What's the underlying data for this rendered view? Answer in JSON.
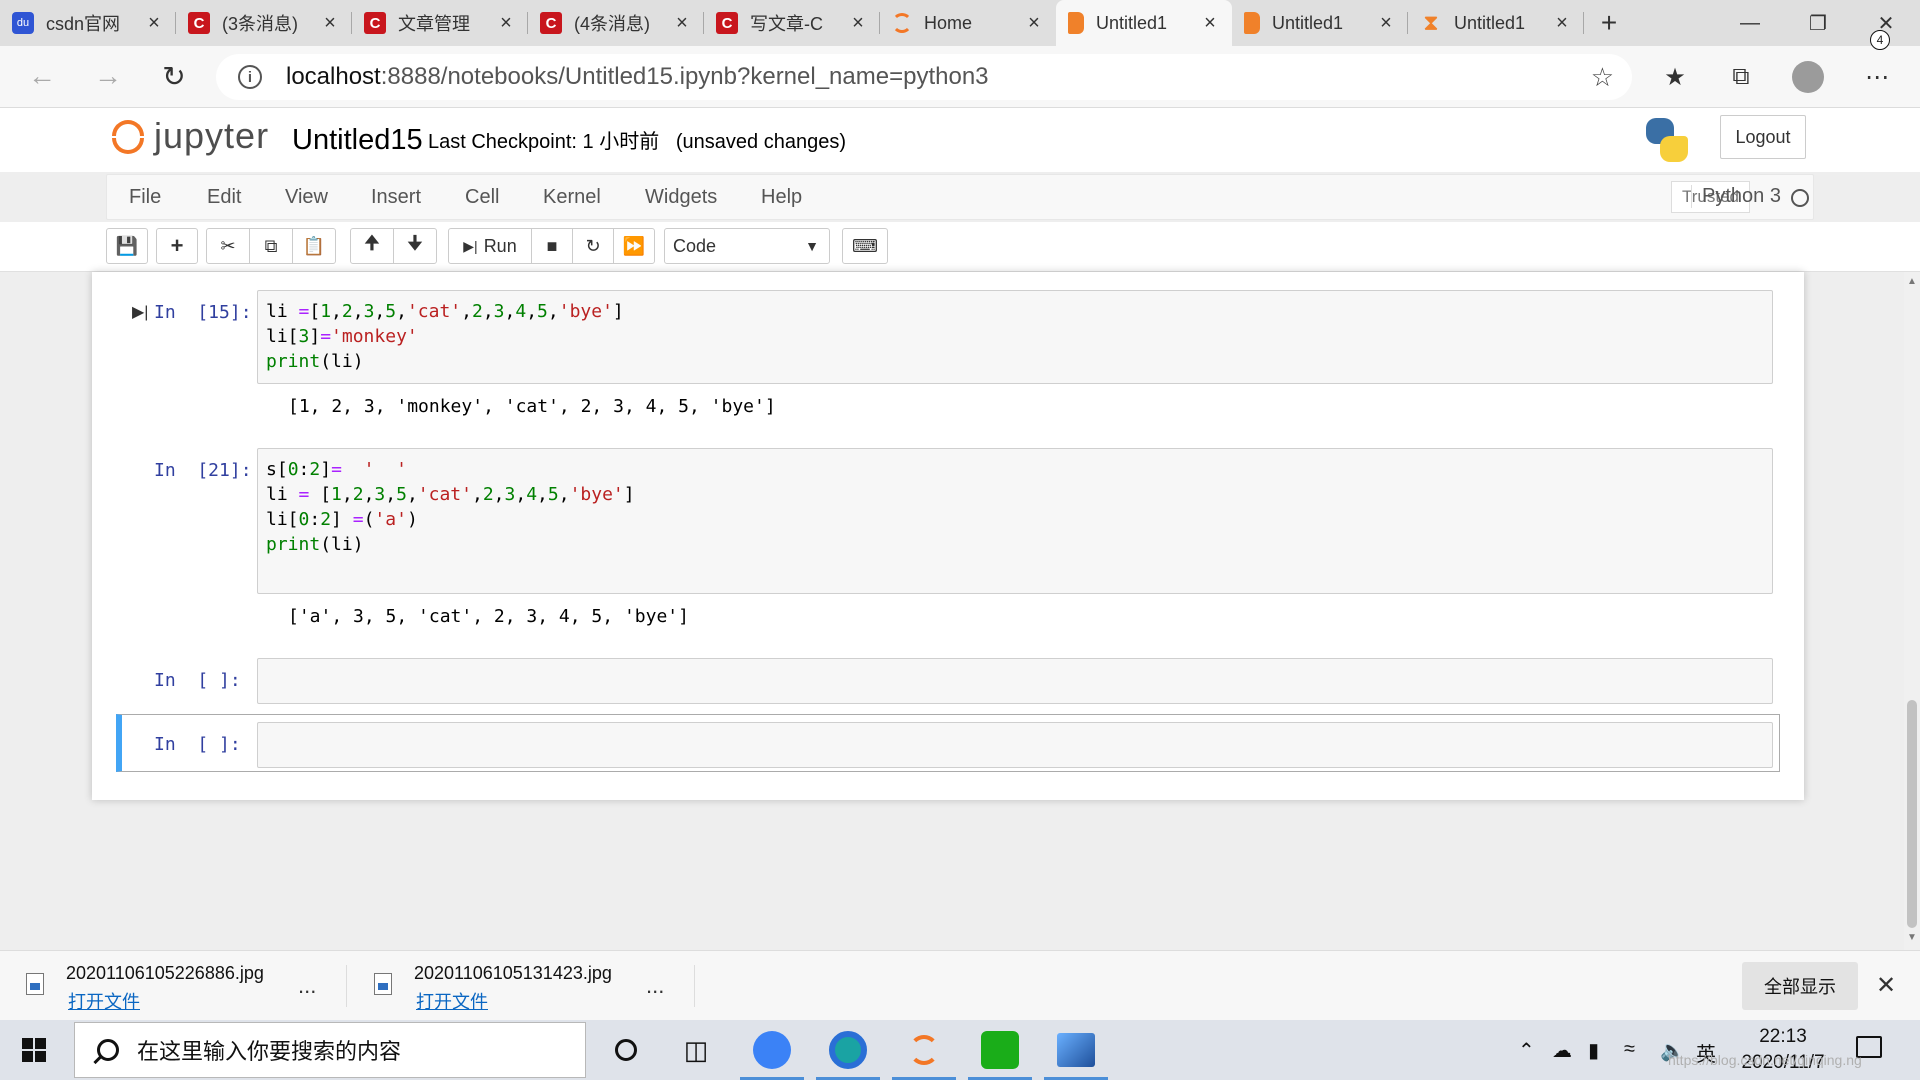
{
  "browser": {
    "tabs": [
      {
        "title": "csdn官网",
        "icon": "paw-icon"
      },
      {
        "title": "(3条消息)",
        "icon": "csdn-icon"
      },
      {
        "title": "文章管理",
        "icon": "csdn-icon"
      },
      {
        "title": "(4条消息)",
        "icon": "csdn-icon"
      },
      {
        "title": "写文章-C",
        "icon": "csdn-icon"
      },
      {
        "title": "Home",
        "icon": "jupyter-ring-icon"
      },
      {
        "title": "Untitled1",
        "icon": "notebook-icon"
      },
      {
        "title": "Untitled1",
        "icon": "notebook-icon"
      },
      {
        "title": "Untitled1",
        "icon": "hourglass-icon"
      }
    ],
    "active_tab_index": 6,
    "new_tab_label": "+",
    "url_host": "localhost",
    "url_path": ":8888/notebooks/Untitled15.ipynb?kernel_name=python3"
  },
  "jupyter": {
    "logo_text": "jupyter",
    "notebook_name": "Untitled15",
    "checkpoint_text": "Last Checkpoint: 1 小时前",
    "status_text": "(unsaved changes)",
    "logout_label": "Logout",
    "menu": [
      "File",
      "Edit",
      "View",
      "Insert",
      "Cell",
      "Kernel",
      "Widgets",
      "Help"
    ],
    "trusted_label": "Trusted",
    "kernel_name": "Python 3",
    "run_label": "Run",
    "cell_type": "Code"
  },
  "cells": [
    {
      "prompt": "In  [15]:",
      "output": "[1, 2, 3, 'monkey', 'cat', 2, 3, 4, 5, 'bye']"
    },
    {
      "prompt": "In  [21]:",
      "output": "['a', 3, 5, 'cat', 2, 3, 4, 5, 'bye']"
    },
    {
      "prompt": "In  [ ]:"
    },
    {
      "prompt": "In  [ ]:"
    }
  ],
  "downloads": [
    {
      "filename": "20201106105226886.jpg",
      "open_label": "打开文件"
    },
    {
      "filename": "20201106105131423.jpg",
      "open_label": "打开文件"
    }
  ],
  "download_bar": {
    "show_all_label": "全部显示",
    "more_label": "..."
  },
  "taskbar": {
    "search_placeholder": "在这里输入你要搜索的内容",
    "ime_label": "英",
    "time": "22:13",
    "date": "2020/11/7",
    "notification_count": "4"
  },
  "watermark": "https://blog.csdn.net/qinqing.ng",
  "colors": {
    "jupyter_orange": "#f37726",
    "prompt_blue": "#303f9f",
    "selected_cell": "#42a5f5"
  }
}
